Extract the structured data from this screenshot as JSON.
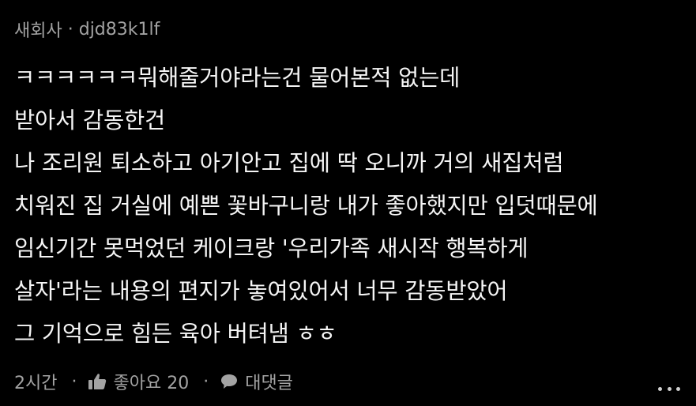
{
  "comment": {
    "app_label": "새회사",
    "separator": "·",
    "username": "djd83k1lf",
    "lines": [
      "ㅋㅋㅋㅋㅋㅋ뭐해줄거야라는건 물어본적 없는데",
      "받아서 감동한건",
      "나 조리원 퇴소하고 아기안고 집에 딱 오니까 거의 새집처럼",
      "치워진 집 거실에 예쁜 꽃바구니랑 내가 좋아했지만 입덧때문에",
      "임신기간 못먹었던 케이크랑 '우리가족 새시작 행복하게",
      "살자'라는 내용의 편지가 놓여있어서 너무 감동받았어",
      "그 기억으로 힘든 육아 버텨냄 ㅎㅎ"
    ],
    "timestamp": "2시간",
    "like_label": "좋아요 20",
    "reply_label": "대댓글",
    "icons": {
      "like": "thumbs-up-icon",
      "reply": "speech-bubble-icon",
      "more": "more-dots-icon"
    },
    "colors": {
      "background": "#000000",
      "text": "#f5f5f5",
      "muted": "#a3a3a3"
    }
  }
}
